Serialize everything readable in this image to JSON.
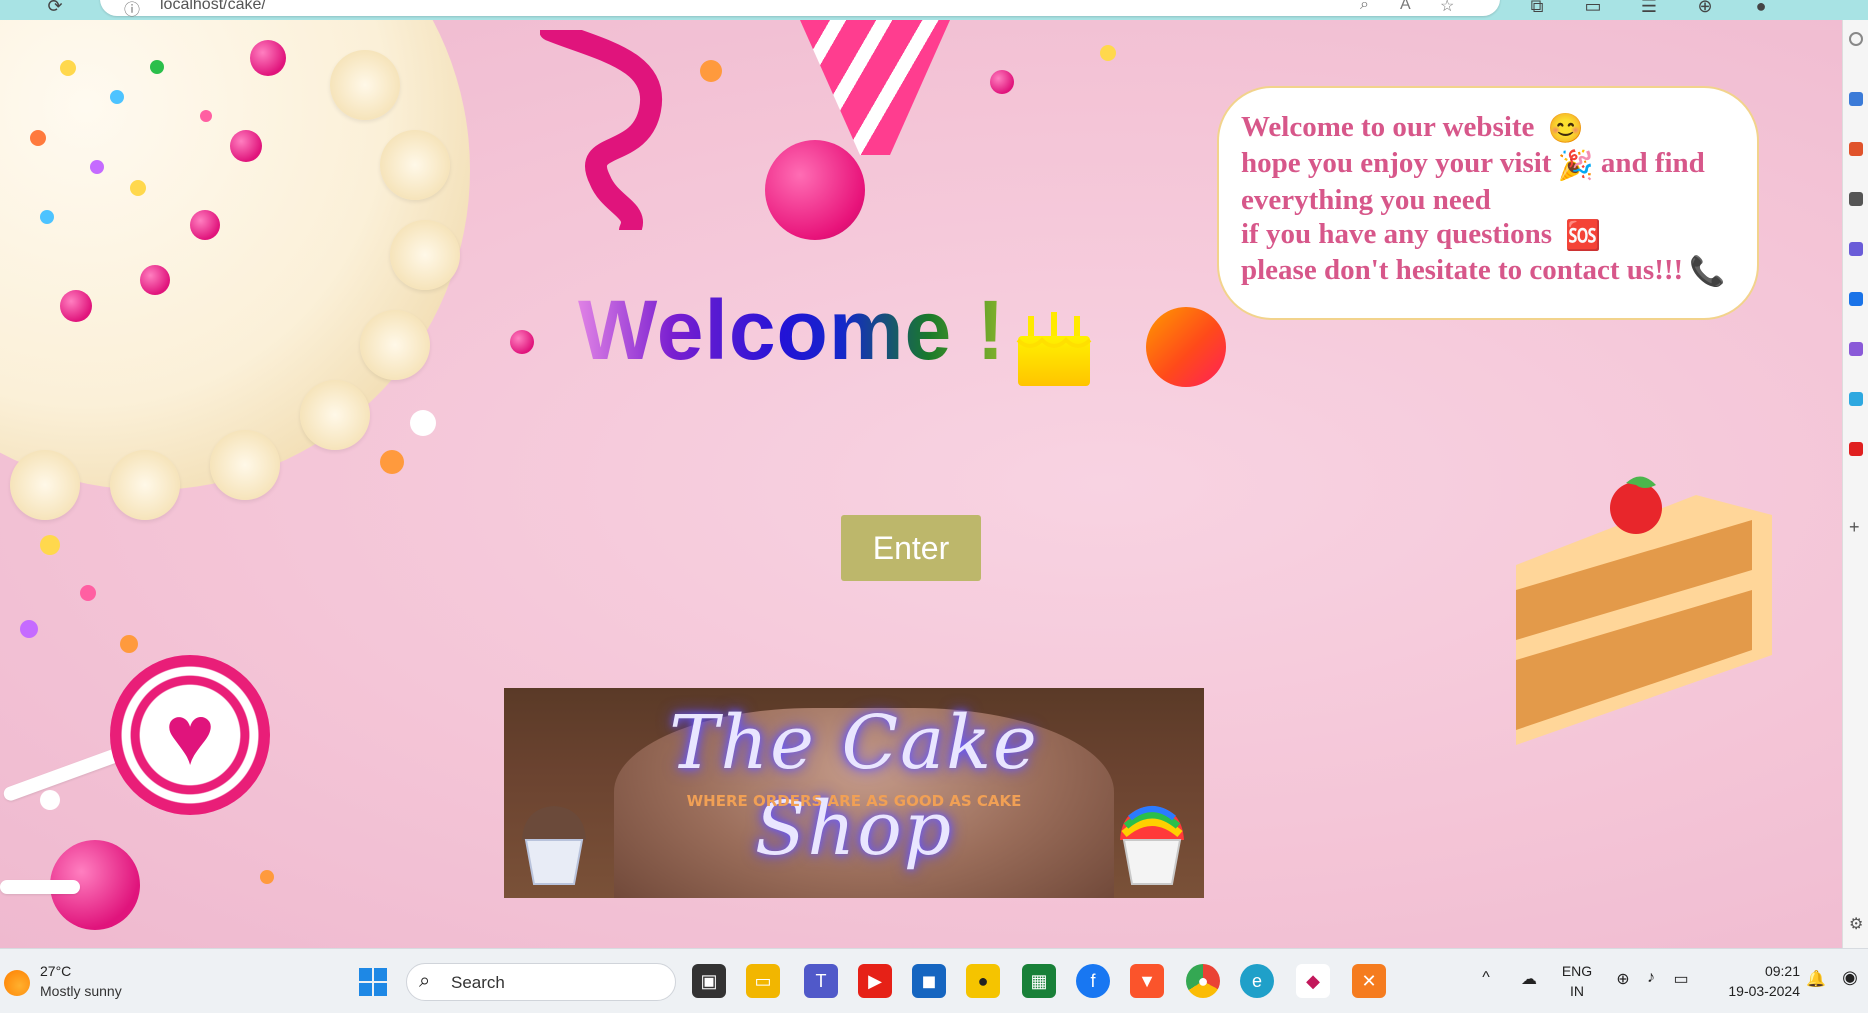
{
  "browser": {
    "url": "localhost/cake/"
  },
  "page": {
    "welcome_heading": "Welcome !",
    "bubble_lines": [
      "Welcome to our website",
      "hope you enjoy your visit",
      "and find",
      "everything you need",
      "if you have any questions",
      "please don't hesitate to contact us!!!"
    ],
    "bubble_emojis": {
      "smile": "😊",
      "party": "🎉",
      "sos": "🆘",
      "phone": "📞"
    },
    "enter_label": "Enter",
    "banner": {
      "title": "The Cake Shop",
      "subtitle": "WHERE ORDERS ARE AS GOOD AS CAKE"
    }
  },
  "taskbar": {
    "weather_temp": "27°C",
    "weather_desc": "Mostly sunny",
    "search_placeholder": "Search",
    "lang_top": "ENG",
    "lang_bottom": "IN",
    "time": "09:21",
    "date": "19-03-2024"
  },
  "colors": {
    "enter_bg": "#bdb76b",
    "bubble_text": "#d7578a",
    "page_bg": "#f4c5d7"
  }
}
